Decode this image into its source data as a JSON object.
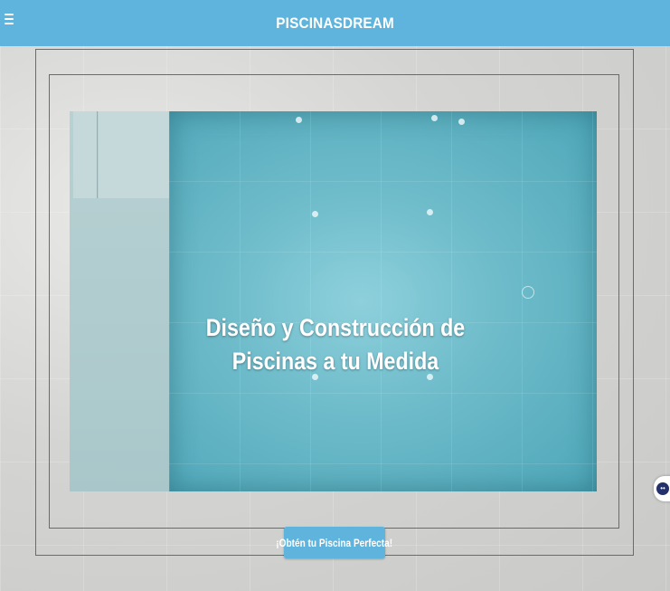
{
  "header": {
    "brand": "PISCINASDREAM",
    "menu_icon": "hamburger-menu-icon",
    "background_color": "#5fb4dd"
  },
  "hero": {
    "headline": "Diseño y Construcción de Piscinas a tu Medida",
    "cta_label": "¡Obtén tu Piscina Perfecta!",
    "cta_color": "#5fb4dd"
  },
  "widget": {
    "icon": "accessibility-widget-icon"
  }
}
